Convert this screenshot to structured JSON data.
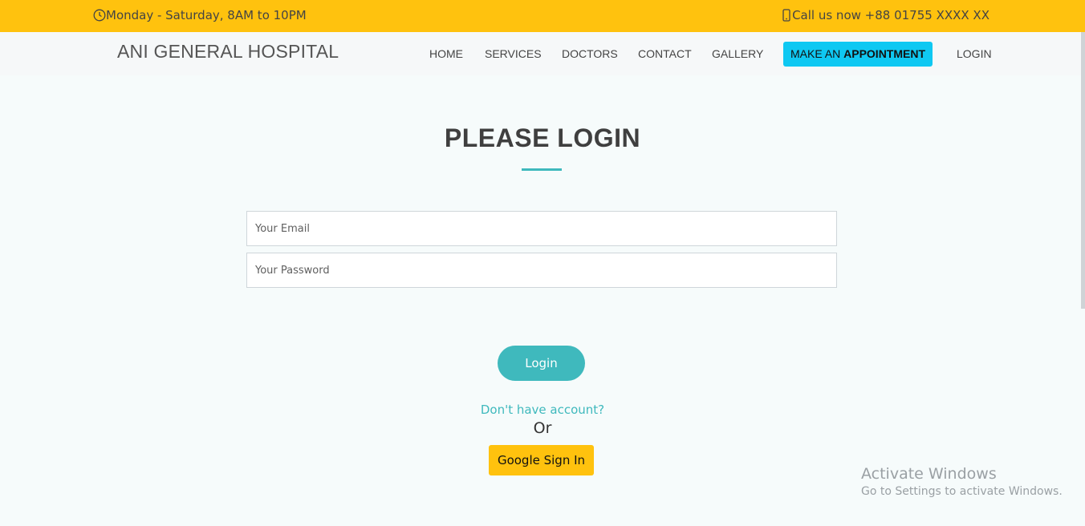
{
  "topbar": {
    "hours": "Monday - Saturday, 8AM to 10PM",
    "call": "Call us now +88 01755 XXXX XX",
    "background": "#ffc20e",
    "icons": [
      "clock-icon",
      "phone-icon"
    ]
  },
  "navbar": {
    "brand": "ANI GENERAL HOSPITAL",
    "items": [
      {
        "label": "HOME"
      },
      {
        "label": "SERVICES"
      },
      {
        "label": "DOCTORS"
      },
      {
        "label": "CONTACT"
      },
      {
        "label": "GALLERY"
      }
    ],
    "appointment": {
      "prefix": "MAKE AN ",
      "emphasis": "APPOINTMENT",
      "color": "#0fc8f2"
    },
    "login": "LOGIN"
  },
  "login": {
    "title": "PLEASE LOGIN",
    "email_placeholder": "Your Email",
    "password_placeholder": "Your Password",
    "button": "Login",
    "no_account": "Don't have account?",
    "or": "Or",
    "google": "Google Sign In",
    "accent": "#3fb9bd"
  },
  "watermark": {
    "line1": "Activate Windows",
    "line2": "Go to Settings to activate Windows."
  }
}
